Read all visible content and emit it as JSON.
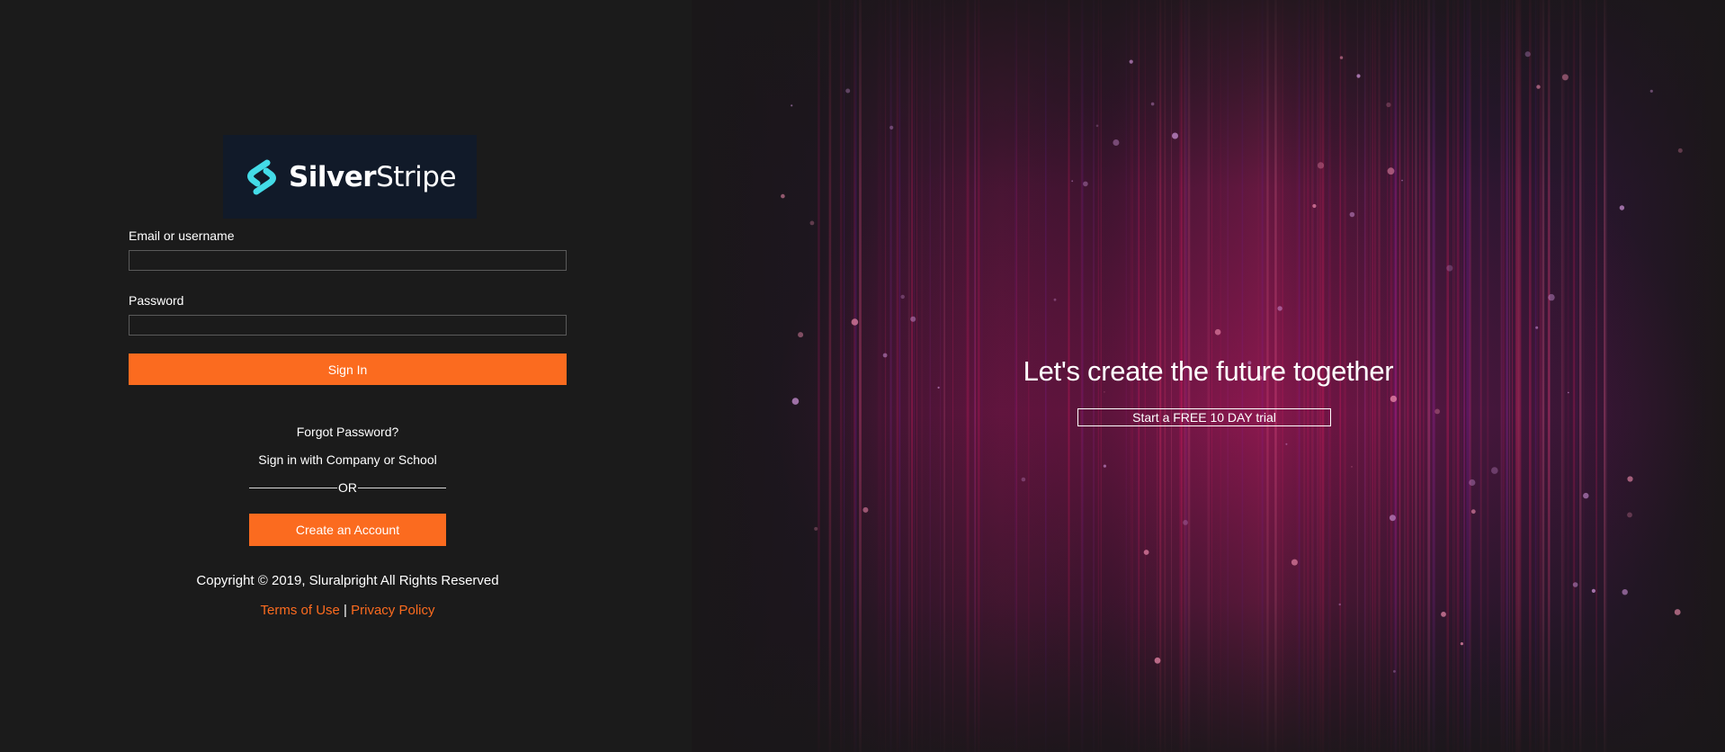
{
  "brand": {
    "name_part1": "Silver",
    "name_part2": "Stripe",
    "logo_icon": "silverstripe-logo-icon",
    "logo_background": "#111a29",
    "logo_icon_color": "#43dbe7"
  },
  "login": {
    "email_label": "Email or username",
    "email_value": "",
    "password_label": "Password",
    "password_value": "",
    "sign_in_label": "Sign In",
    "forgot_password": "Forgot Password?",
    "company_sign_in": "Sign in with Company or School",
    "or_text": "OR",
    "create_account_label": "Create an Account"
  },
  "footer": {
    "copyright": "Copyright © 2019, Sluralpright All Rights Reserved",
    "terms_label": "Terms of Use",
    "separator": "|",
    "privacy_label": "Privacy Policy"
  },
  "hero": {
    "title": "Let's create the future together",
    "trial_label": "Start a FREE 10 DAY trial"
  },
  "colors": {
    "accent": "#fb6b1f",
    "page_background": "#1b1b1b",
    "hero_glow": "#b3174f"
  }
}
